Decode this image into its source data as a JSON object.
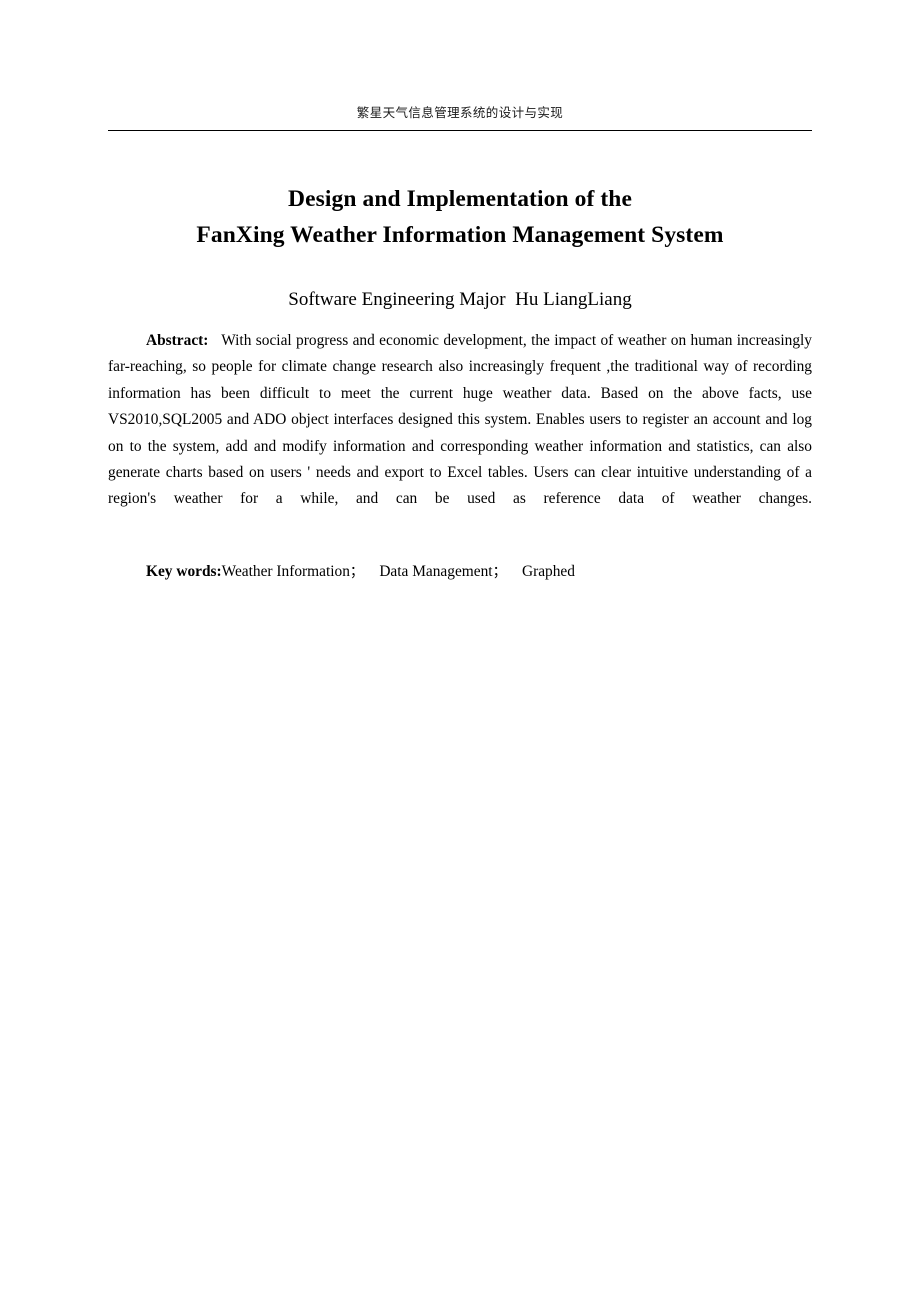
{
  "page": {
    "background_color": "#ffffff",
    "text_color": "#000000"
  },
  "header": {
    "running_title": "繁星天气信息管理系统的设计与实现",
    "rule_color": "#000000"
  },
  "title": {
    "line1": "Design and Implementation of the",
    "line2": "FanXing Weather Information Management System"
  },
  "byline": {
    "text": "Software Engineering Major  Hu LiangLiang"
  },
  "abstract": {
    "label": "Abstract:",
    "label_gap": "   ",
    "body": "With social progress and economic development, the impact of weather on human increasingly far-reaching, so people for climate change research also increasingly frequent ,the traditional way of recording information has been difficult to meet the current huge weather data. Based on the above facts, use VS2010,SQL2005 and ADO object interfaces designed this system. Enables users to register an account and log on to the system, add and modify information and corresponding weather information and statistics, can also generate charts based on users ' needs and export to Excel tables. Users can clear intuitive understanding of a region's weather for a while, and can be used as reference data of weather changes."
  },
  "keywords": {
    "label": "Key words:",
    "items": [
      "Weather Information",
      "Data Management",
      "Graphed"
    ],
    "separator": "；",
    "item_gap": "    ",
    "term1": "Weather Information",
    "term2": "Data Management",
    "term3": "Graphed"
  }
}
